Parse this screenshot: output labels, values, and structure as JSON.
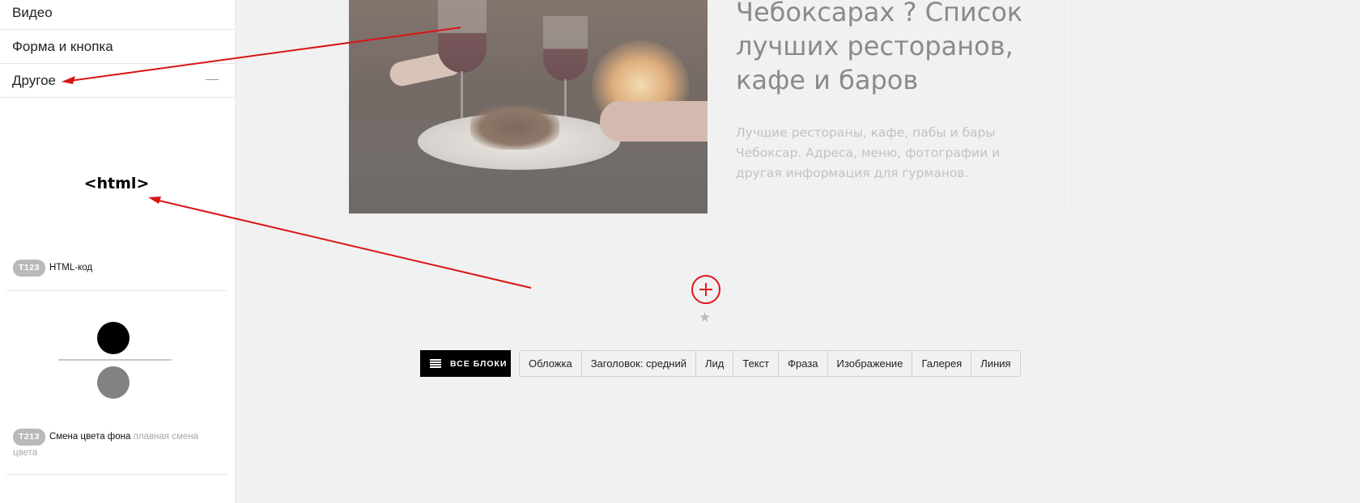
{
  "sidebar": {
    "items": [
      {
        "label": "Видео"
      },
      {
        "label": "Форма и кнопка"
      },
      {
        "label": "Другое",
        "expanded_marker": "—"
      }
    ],
    "cards": [
      {
        "preview_text": "<html>",
        "badge": "T123",
        "title": "HTML-код",
        "desc": ""
      },
      {
        "badge": "T213",
        "title": "Смена цвета фона",
        "desc": "плавная смена цвета"
      }
    ]
  },
  "canvas": {
    "heading_lines": [
      "Чебоксарах ? Список",
      "лучших ресторанов,",
      "кафе и баров"
    ],
    "subtext": "Лучшие рестораны, кафе, пабы и бары Чебоксар. Адреса, меню, фотографии и другая информация для гурманов.",
    "star": "★"
  },
  "toolbar": {
    "all_blocks_label": "ВСЕ БЛОКИ",
    "tabs": [
      "Обложка",
      "Заголовок: средний",
      "Лид",
      "Текст",
      "Фраза",
      "Изображение",
      "Галерея",
      "Линия"
    ]
  },
  "colors": {
    "accent_red": "#e0161c",
    "arrow_red": "#d91414"
  }
}
